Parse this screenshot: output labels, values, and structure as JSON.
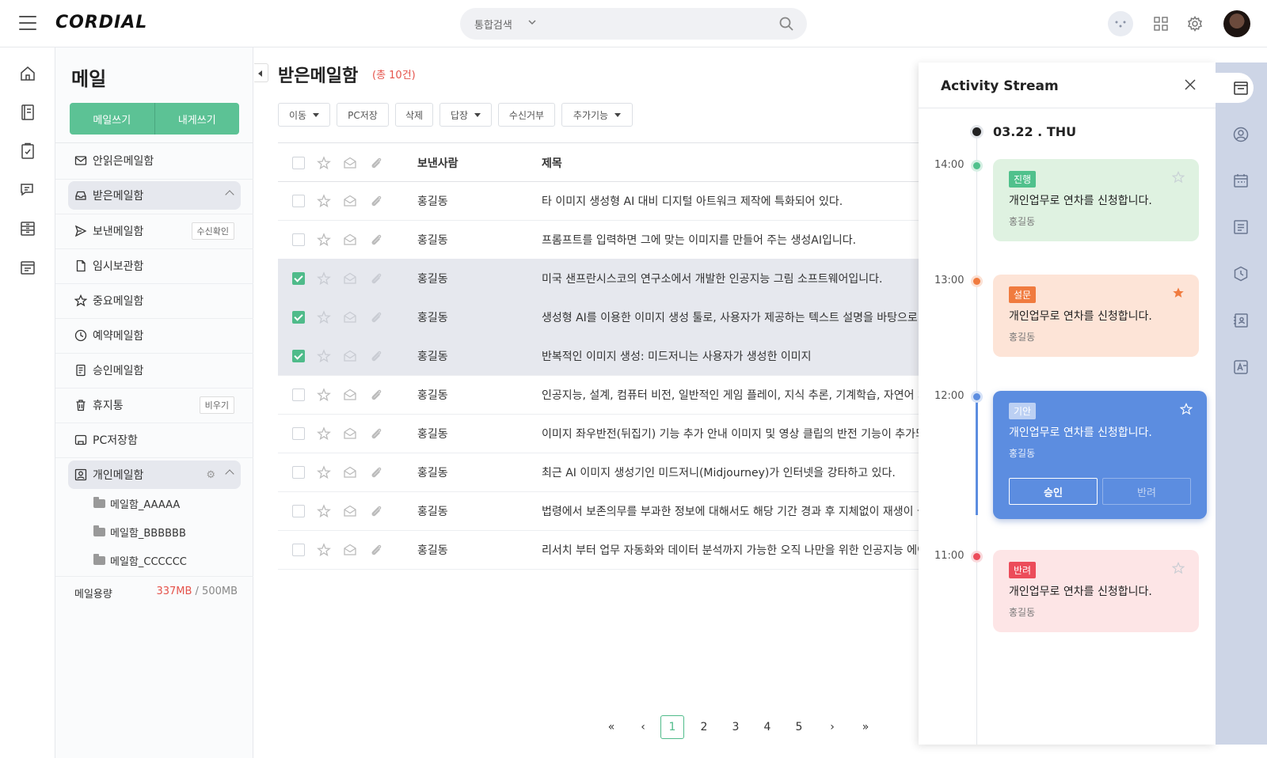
{
  "header": {
    "logo": "CORDIAL",
    "search_scope": "통합검색"
  },
  "sidebar": {
    "title": "메일",
    "compose": "메일쓰기",
    "self_compose": "내게쓰기",
    "items": [
      {
        "label": "안읽은메일함",
        "icon": "envelope-icon"
      },
      {
        "label": "받은메일함",
        "icon": "inbox-icon",
        "active": true
      },
      {
        "label": "보낸메일함",
        "icon": "send-icon",
        "tag": "수신확인"
      },
      {
        "label": "임시보관함",
        "icon": "file-icon"
      },
      {
        "label": "중요메일함",
        "icon": "star-icon"
      },
      {
        "label": "예약메일함",
        "icon": "clock-icon"
      },
      {
        "label": "승인메일함",
        "icon": "approval-doc-icon"
      },
      {
        "label": "휴지통",
        "icon": "trash-icon",
        "tag": "비우기"
      },
      {
        "label": "PC저장함",
        "icon": "pc-save-icon"
      },
      {
        "label": "개인메일함",
        "icon": "person-box-icon"
      }
    ],
    "folders": [
      "메일함_AAAAA",
      "메일함_BBBBBB",
      "메일함_CCCCCC"
    ],
    "quota_label": "메일용량",
    "quota_used": "337MB",
    "quota_sep": " / ",
    "quota_total": "500MB"
  },
  "main": {
    "title": "받은메일함",
    "count": "(총 10건)",
    "toolbar": [
      "이동",
      "PC저장",
      "삭제",
      "답장",
      "수신거부",
      "추가기능"
    ],
    "columns": {
      "sender": "보낸사람",
      "subject": "제목"
    },
    "rows": [
      {
        "sender": "홍길동",
        "subject": "타 이미지 생성형 AI 대비 디지털 아트워크 제작에 특화되어 있다.",
        "checked": false
      },
      {
        "sender": "홍길동",
        "subject": "프롬프트를 입력하면 그에 맞는 이미지를 만들어 주는 생성AI입니다.",
        "checked": false
      },
      {
        "sender": "홍길동",
        "subject": "미국 샌프란시스코의 연구소에서 개발한 인공지능 그림 소프트웨어입니다.",
        "checked": true
      },
      {
        "sender": "홍길동",
        "subject": "생성형 AI를 이용한 이미지 생성 툴로, 사용자가 제공하는 텍스트 설명을 바탕으로 시",
        "checked": true
      },
      {
        "sender": "홍길동",
        "subject": "반복적인 이미지 생성: 미드저니는 사용자가 생성한 이미지",
        "checked": true
      },
      {
        "sender": "홍길동",
        "subject": "인공지능, 설계, 컴퓨터 비전, 일반적인 게임 플레이, 지식 추론, 기계학습, 자연어 처리",
        "checked": false
      },
      {
        "sender": "홍길동",
        "subject": "이미지 좌우반전(뒤집기) 기능 추가 안내 이미지 및 영상 클립의 반전 기능이 추가되었",
        "checked": false
      },
      {
        "sender": "홍길동",
        "subject": "최근 AI 이미지 생성기인 미드저니(Midjourney)가 인터넷을 강타하고 있다.",
        "checked": false
      },
      {
        "sender": "홍길동",
        "subject": "법령에서 보존의무를 부과한 정보에 대해서도 해당 기간 경과 후 지체없이 재생이 불가",
        "checked": false
      },
      {
        "sender": "홍길동",
        "subject": "리서치 부터 업무 자동화와 데이터 분석까지 가능한 오직 나만을 위한 인공지능 에이전",
        "checked": false
      }
    ],
    "pages": [
      "1",
      "2",
      "3",
      "4",
      "5"
    ],
    "current_page": "1"
  },
  "activity": {
    "title": "Activity Stream",
    "date": "03.22 . THU",
    "entries": [
      {
        "time": "14:00",
        "badge": "진행",
        "message": "개인업무로 연차를 신청합니다.",
        "author": "홍길동",
        "starred": false,
        "color": "#50c18c"
      },
      {
        "time": "13:00",
        "badge": "설문",
        "message": "개인업무로 연차를 신청합니다.",
        "author": "홍길동",
        "starred": true,
        "color": "#f07b3f"
      },
      {
        "time": "12:00",
        "badge": "기안",
        "message": "개인업무로 연차를 신청합니다.",
        "author": "홍길동",
        "starred": false,
        "color": "#5c8de0",
        "approve": "승인",
        "reject": "반려"
      },
      {
        "time": "11:00",
        "badge": "반려",
        "message": "개인업무로 연차를 신청합니다.",
        "author": "홍길동",
        "starred": false,
        "color": "#ec4c5a"
      }
    ]
  },
  "colors": {
    "accent": "#5cc295",
    "danger": "#e5534b",
    "panel_blue": "#5c8de0"
  }
}
